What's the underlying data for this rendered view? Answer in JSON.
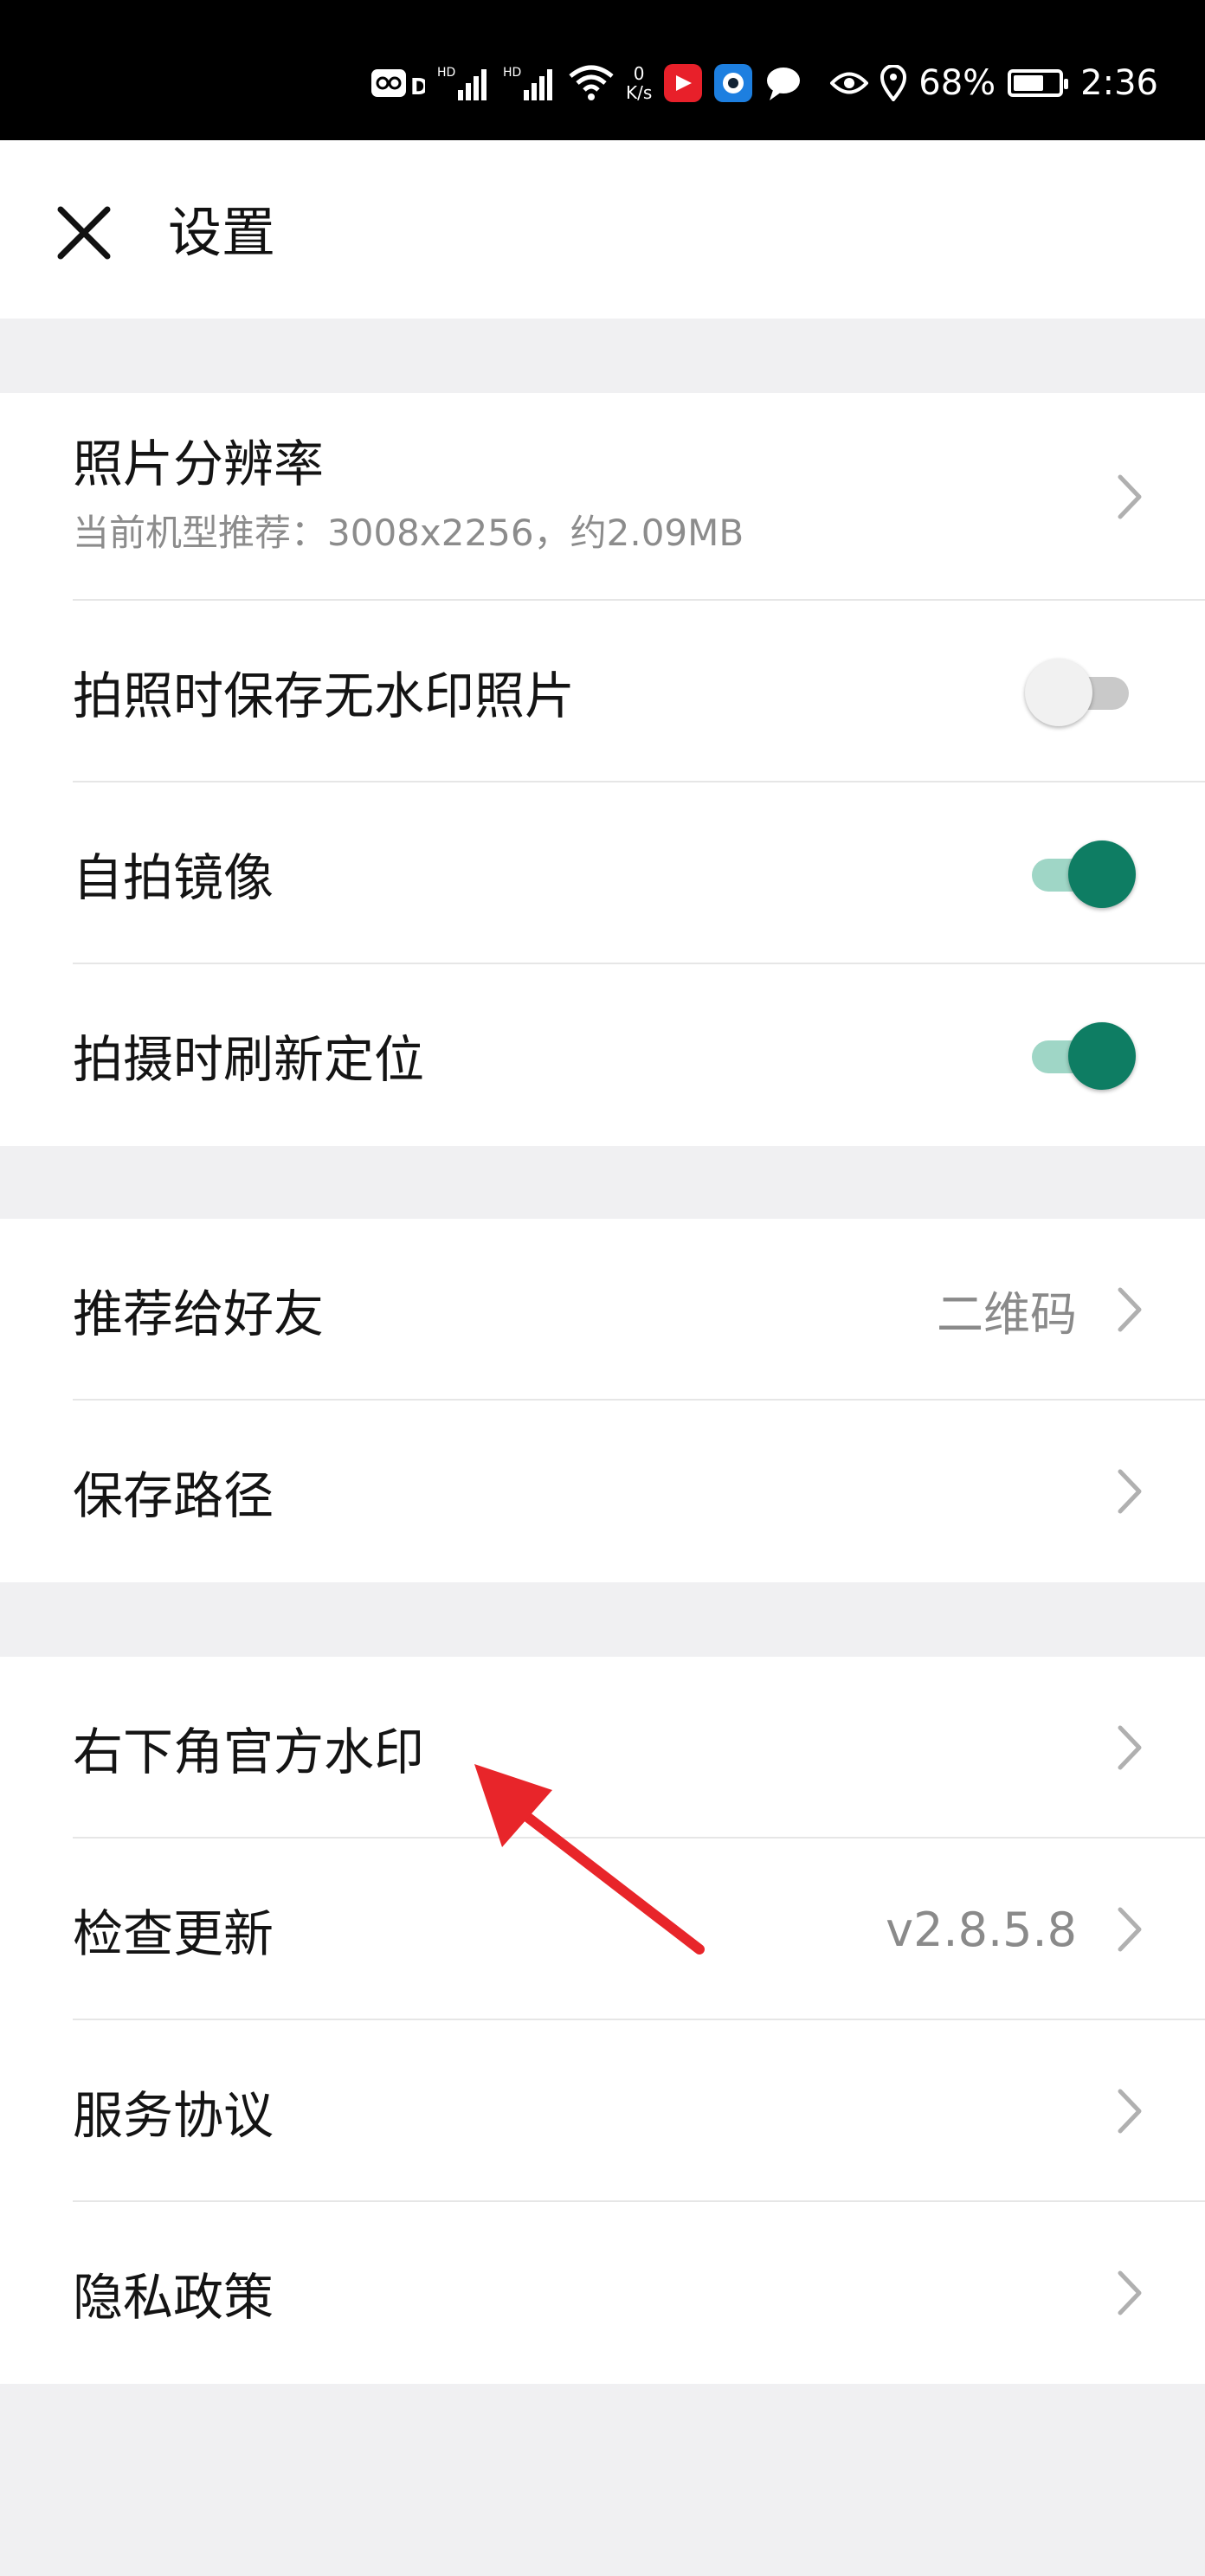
{
  "status_bar": {
    "net_speed_value": "0",
    "net_speed_unit": "K/s",
    "battery_percent": "68%",
    "battery_level": 0.68,
    "time": "2:36",
    "signal_label_1": "HD",
    "signal_label_2": "HD",
    "icons": [
      "hd-voice-icon",
      "signal-icon",
      "signal-icon",
      "wifi-icon",
      "net-speed",
      "video-app-icon",
      "camera-app-icon",
      "chat-bubble-icon",
      "eye-icon",
      "location-icon",
      "battery-icon"
    ]
  },
  "header": {
    "title": "设置",
    "close_icon": "close-icon"
  },
  "section1": {
    "resolution": {
      "label": "照片分辨率",
      "sub": "当前机型推荐：3008x2256，约2.09MB"
    },
    "no_watermark": {
      "label": "拍照时保存无水印照片",
      "on": false
    },
    "selfie_mirror": {
      "label": "自拍镜像",
      "on": true
    },
    "refresh_location": {
      "label": "拍摄时刷新定位",
      "on": true
    }
  },
  "section2": {
    "recommend": {
      "label": "推荐给好友",
      "value": "二维码"
    },
    "save_path": {
      "label": "保存路径"
    }
  },
  "section3": {
    "official_watermark": {
      "label": "右下角官方水印"
    },
    "check_update": {
      "label": "检查更新",
      "value": "v2.8.5.8"
    },
    "service_agreement": {
      "label": "服务协议"
    },
    "privacy_policy": {
      "label": "隐私政策"
    }
  },
  "colors": {
    "toggle_on": "#0e7d63",
    "toggle_on_track": "#9fd6c6",
    "annotation_arrow": "#e8252a",
    "background": "#f0f0f2"
  }
}
